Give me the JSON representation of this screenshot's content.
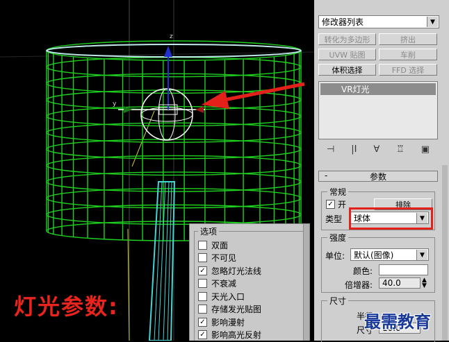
{
  "viewport": {
    "overlay_label": "灯光参数:"
  },
  "options_panel": {
    "title": "选项",
    "items": [
      {
        "label": "双面",
        "checked": false
      },
      {
        "label": "不可见",
        "checked": false
      },
      {
        "label": "忽略灯光法线",
        "checked": true
      },
      {
        "label": "不衰减",
        "checked": false
      },
      {
        "label": "天光入口",
        "checked": false
      },
      {
        "label": "存储发光贴图",
        "checked": false
      },
      {
        "label": "影响漫射",
        "checked": true
      },
      {
        "label": "影响高光反射",
        "checked": true
      }
    ]
  },
  "modifier_panel": {
    "modifier_list": "修改器列表",
    "buttons": {
      "to_poly": "转化为多边形",
      "extrude": "挤出",
      "uvw_map": "UVW 贴图",
      "lathe": "车削",
      "vol_select": "体积选择",
      "ffd_select": "FFD 选择"
    },
    "stack_item": "VR灯光",
    "stack_tools": [
      "⊣",
      "|I",
      "∀",
      "♖",
      "▣"
    ],
    "rollout_title": "参数",
    "general": {
      "title": "常规",
      "on_label": "开",
      "on_checked": true,
      "exclude_button": "排除",
      "type_label": "类型",
      "type_value": "球体"
    },
    "intensity": {
      "title": "强度",
      "unit_label": "单位:",
      "unit_value": "默认(图像)",
      "color_label": "颜色:",
      "color_value": "#ffffff",
      "multiplier_label": "倍增器:",
      "multiplier_value": "40.0"
    },
    "size": {
      "title": "尺寸",
      "radius_label": "半径",
      "size_label": "尺寸",
      "size_value": "10.0"
    }
  },
  "watermark": "最需教育"
}
